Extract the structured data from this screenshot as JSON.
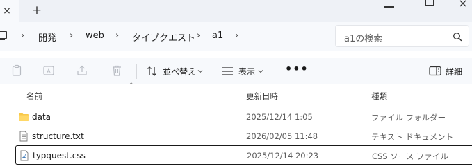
{
  "tab": {
    "close_glyph": "×",
    "new_tab_glyph": "+"
  },
  "breadcrumb": {
    "items": [
      "開発",
      "web",
      "タイプクエスト",
      "a1"
    ],
    "separator": "›"
  },
  "search": {
    "placeholder": "a1の検索"
  },
  "toolbar": {
    "sort_label": "並べ替え",
    "view_label": "表示",
    "more_label": "•••",
    "details_label": "詳細"
  },
  "columns": {
    "name": "名前",
    "modified": "更新日時",
    "type": "種類",
    "sort_indicator": "^"
  },
  "files": [
    {
      "name": "data",
      "modified": "2025/12/14 1:05",
      "type": "ファイル フォルダー",
      "icon": "folder-icon"
    },
    {
      "name": "structure.txt",
      "modified": "2026/02/05 11:48",
      "type": "テキスト ドキュメント",
      "icon": "text-file-icon"
    },
    {
      "name": "typquest.css",
      "modified": "2025/12/14 20:23",
      "type": "CSS ソース ファイル",
      "icon": "css-file-icon"
    }
  ],
  "colors": {
    "accent": "#0067c0",
    "folder": "#f8c94a",
    "chrome_bg": "#eef1f6",
    "toolbar_bg": "#f7f9fc"
  }
}
